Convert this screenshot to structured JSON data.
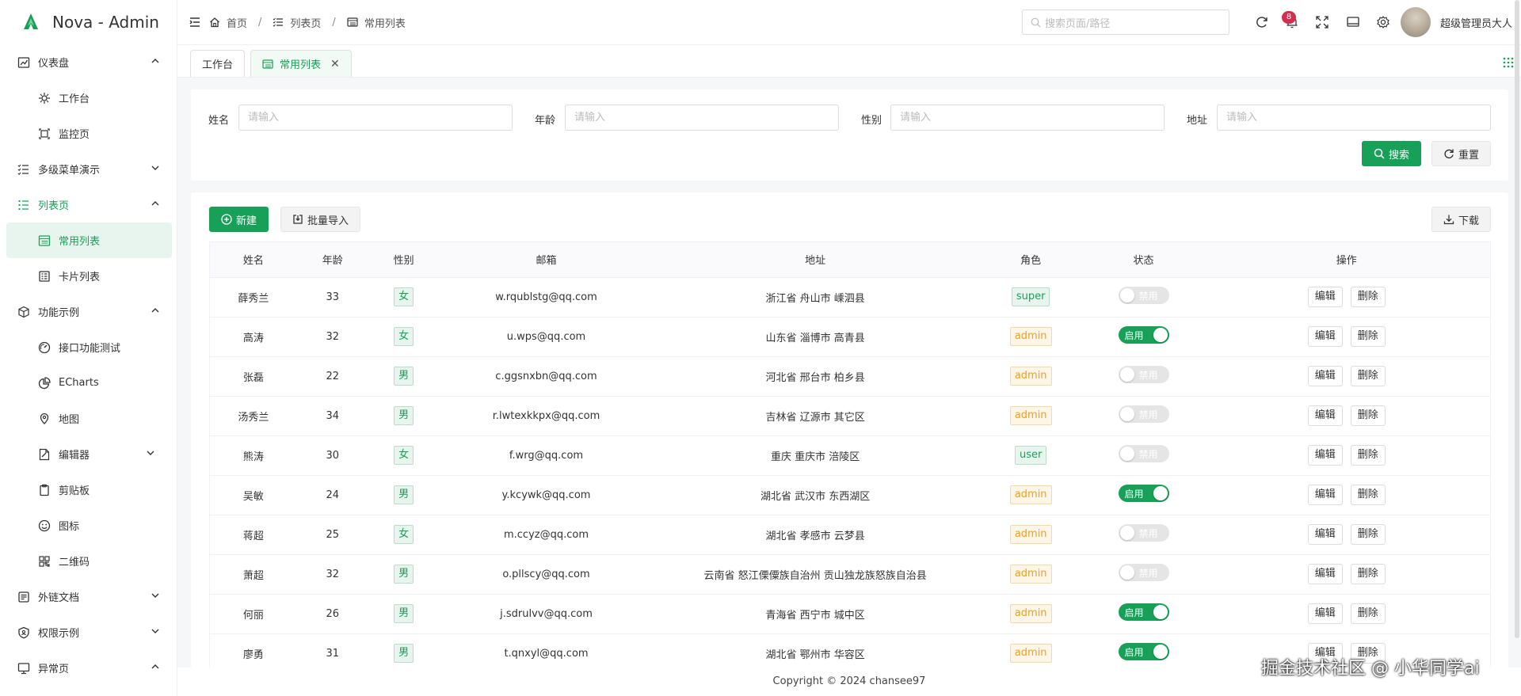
{
  "app": {
    "title": "Nova - Admin"
  },
  "sidebar": {
    "items": [
      {
        "label": "仪表盘",
        "icon": "dashboard-icon",
        "level": 1,
        "chevron": "up"
      },
      {
        "label": "工作台",
        "icon": "workbench-icon",
        "level": 2
      },
      {
        "label": "监控页",
        "icon": "monitor-icon",
        "level": 2
      },
      {
        "label": "多级菜单演示",
        "icon": "list-check-icon",
        "level": 1,
        "chevron": "down"
      },
      {
        "label": "列表页",
        "icon": "list-icon",
        "level": 1,
        "chevron": "up",
        "activeParent": true
      },
      {
        "label": "常用列表",
        "icon": "table-list-icon",
        "level": 2,
        "active": true
      },
      {
        "label": "卡片列表",
        "icon": "card-list-icon",
        "level": 2
      },
      {
        "label": "功能示例",
        "icon": "cube-icon",
        "level": 1,
        "chevron": "up"
      },
      {
        "label": "接口功能测试",
        "icon": "speedometer-icon",
        "level": 2
      },
      {
        "label": "ECharts",
        "icon": "pie-chart-icon",
        "level": 2
      },
      {
        "label": "地图",
        "icon": "map-icon",
        "level": 2
      },
      {
        "label": "编辑器",
        "icon": "editor-icon",
        "level": 2,
        "chevron": "down"
      },
      {
        "label": "剪贴板",
        "icon": "clipboard-icon",
        "level": 2
      },
      {
        "label": "图标",
        "icon": "smile-icon",
        "level": 2
      },
      {
        "label": "二维码",
        "icon": "qrcode-icon",
        "level": 2
      },
      {
        "label": "外链文档",
        "icon": "document-icon",
        "level": 1,
        "chevron": "down"
      },
      {
        "label": "权限示例",
        "icon": "shield-icon",
        "level": 1,
        "chevron": "down"
      },
      {
        "label": "异常页",
        "icon": "monitor-error-icon",
        "level": 1,
        "chevron": "up"
      }
    ]
  },
  "header": {
    "breadcrumb": [
      "首页",
      "列表页",
      "常用列表"
    ],
    "search_placeholder": "搜索页面/路径",
    "notification_count": "8",
    "user_name": "超级管理员大人"
  },
  "tabs": [
    {
      "label": "工作台",
      "active": false
    },
    {
      "label": "常用列表",
      "active": true,
      "closable": true
    }
  ],
  "filters": {
    "fields": [
      {
        "label": "姓名",
        "placeholder": "请输入"
      },
      {
        "label": "年龄",
        "placeholder": "请输入"
      },
      {
        "label": "性别",
        "placeholder": "请输入"
      },
      {
        "label": "地址",
        "placeholder": "请输入"
      }
    ],
    "search_label": "搜索",
    "reset_label": "重置"
  },
  "toolbar": {
    "new_label": "新建",
    "import_label": "批量导入",
    "download_label": "下载"
  },
  "table": {
    "columns": [
      "姓名",
      "年龄",
      "性别",
      "邮箱",
      "地址",
      "角色",
      "状态",
      "操作"
    ],
    "edit_label": "编辑",
    "delete_label": "删除",
    "rows": [
      {
        "name": "薛秀兰",
        "age": "33",
        "gender": "女",
        "email": "w.rqublstg@qq.com",
        "address": "浙江省 舟山市 嵊泗县",
        "role": "super",
        "status": "禁用",
        "enabled": false
      },
      {
        "name": "高涛",
        "age": "32",
        "gender": "女",
        "email": "u.wps@qq.com",
        "address": "山东省 淄博市 高青县",
        "role": "admin",
        "status": "启用",
        "enabled": true
      },
      {
        "name": "张磊",
        "age": "22",
        "gender": "男",
        "email": "c.ggsnxbn@qq.com",
        "address": "河北省 邢台市 柏乡县",
        "role": "admin",
        "status": "禁用",
        "enabled": false
      },
      {
        "name": "汤秀兰",
        "age": "34",
        "gender": "男",
        "email": "r.lwtexkkpx@qq.com",
        "address": "吉林省 辽源市 其它区",
        "role": "admin",
        "status": "禁用",
        "enabled": false
      },
      {
        "name": "熊涛",
        "age": "30",
        "gender": "女",
        "email": "f.wrg@qq.com",
        "address": "重庆 重庆市 涪陵区",
        "role": "user",
        "status": "禁用",
        "enabled": false
      },
      {
        "name": "吴敏",
        "age": "24",
        "gender": "男",
        "email": "y.kcywk@qq.com",
        "address": "湖北省 武汉市 东西湖区",
        "role": "admin",
        "status": "启用",
        "enabled": true
      },
      {
        "name": "蒋超",
        "age": "25",
        "gender": "女",
        "email": "m.ccyz@qq.com",
        "address": "湖北省 孝感市 云梦县",
        "role": "admin",
        "status": "禁用",
        "enabled": false
      },
      {
        "name": "萧超",
        "age": "32",
        "gender": "男",
        "email": "o.pllscy@qq.com",
        "address": "云南省 怒江傈僳族自治州 贡山独龙族怒族自治县",
        "role": "admin",
        "status": "禁用",
        "enabled": false
      },
      {
        "name": "何丽",
        "age": "26",
        "gender": "男",
        "email": "j.sdrulvv@qq.com",
        "address": "青海省 西宁市 城中区",
        "role": "admin",
        "status": "启用",
        "enabled": true
      },
      {
        "name": "廖勇",
        "age": "31",
        "gender": "男",
        "email": "t.qnxyl@qq.com",
        "address": "湖北省 鄂州市 华容区",
        "role": "admin",
        "status": "启用",
        "enabled": true
      }
    ]
  },
  "footer": {
    "copyright": "Copyright © 2024 chansee97"
  },
  "watermark": "掘金技术社区 @ 小华同学ai",
  "colors": {
    "primary": "#18a058",
    "warning": "#f0a020",
    "danger": "#d03050"
  }
}
